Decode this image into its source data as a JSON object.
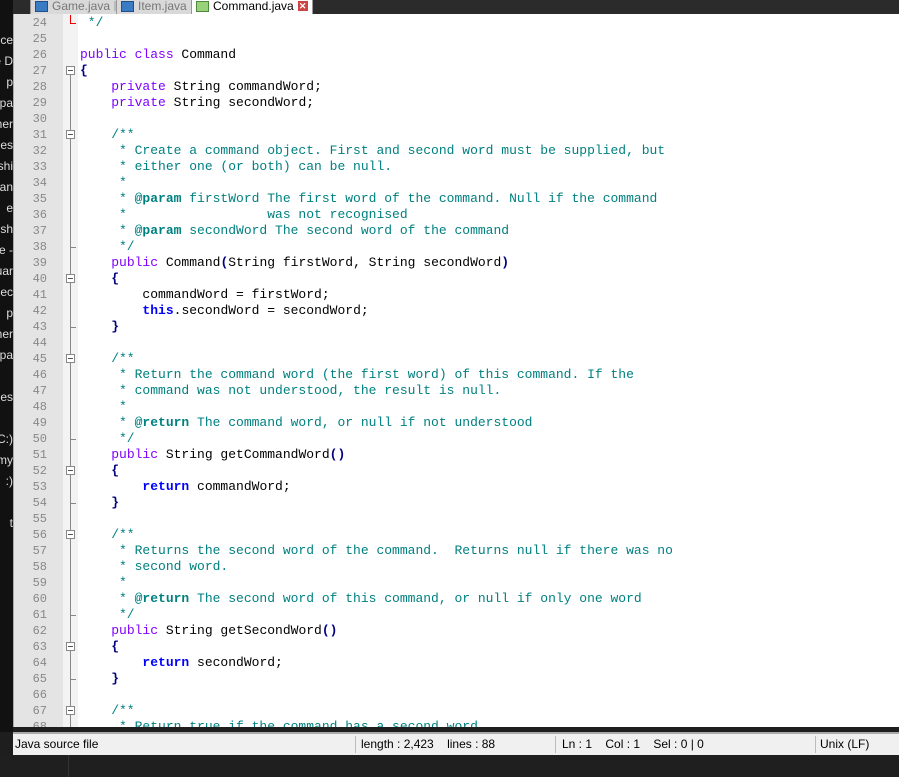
{
  "left_panel": {
    "items": [
      "cce",
      "e D",
      "p",
      "pa",
      "ner",
      "es",
      "shi",
      "an",
      "e",
      "sh",
      "e -",
      "uar",
      "ec",
      "p",
      "ner",
      "pa",
      "",
      "es",
      "",
      "C:)",
      "my",
      ":)",
      "",
      "t"
    ]
  },
  "tabs": [
    {
      "label": "Game.java",
      "active": false
    },
    {
      "label": "Item.java",
      "active": false
    },
    {
      "label": "Command.java",
      "active": true
    }
  ],
  "colors": {
    "keyword": "#8000ff",
    "keyword_bold": "#0000ff",
    "comment": "#008080",
    "fold_end_highlight": "#ee0000"
  },
  "editor": {
    "lines": [
      {
        "n": "24",
        "fold": "end-red",
        "tokens": [
          [
            "c",
            " */"
          ]
        ]
      },
      {
        "n": "25",
        "fold": "",
        "tokens": []
      },
      {
        "n": "26",
        "fold": "",
        "tokens": [
          [
            "k",
            "public class "
          ],
          [
            "p",
            "Command"
          ]
        ]
      },
      {
        "n": "27",
        "fold": "open-top",
        "tokens": [
          [
            "o",
            "{"
          ]
        ]
      },
      {
        "n": "28",
        "fold": "line",
        "tokens": [
          [
            "p",
            "    "
          ],
          [
            "k",
            "private "
          ],
          [
            "p",
            "String commandWord;"
          ]
        ]
      },
      {
        "n": "29",
        "fold": "line",
        "tokens": [
          [
            "p",
            "    "
          ],
          [
            "k",
            "private "
          ],
          [
            "p",
            "String secondWord;"
          ]
        ]
      },
      {
        "n": "30",
        "fold": "line",
        "tokens": []
      },
      {
        "n": "31",
        "fold": "open",
        "tokens": [
          [
            "c",
            "    /**"
          ]
        ]
      },
      {
        "n": "32",
        "fold": "line",
        "tokens": [
          [
            "c",
            "     * Create a command object. First and second word must be supplied, but"
          ]
        ]
      },
      {
        "n": "33",
        "fold": "line",
        "tokens": [
          [
            "c",
            "     * either one (or both) can be null."
          ]
        ]
      },
      {
        "n": "34",
        "fold": "line",
        "tokens": [
          [
            "c",
            "     *"
          ]
        ]
      },
      {
        "n": "35",
        "fold": "line",
        "tokens": [
          [
            "c",
            "     * "
          ],
          [
            "cb",
            "@param"
          ],
          [
            "c",
            " firstWord The first word of the command. Null if the command"
          ]
        ]
      },
      {
        "n": "36",
        "fold": "line",
        "tokens": [
          [
            "c",
            "     *                  was not recognised"
          ]
        ]
      },
      {
        "n": "37",
        "fold": "line",
        "tokens": [
          [
            "c",
            "     * "
          ],
          [
            "cb",
            "@param"
          ],
          [
            "c",
            " secondWord The second word of the command"
          ]
        ]
      },
      {
        "n": "38",
        "fold": "end",
        "tokens": [
          [
            "c",
            "     */"
          ]
        ]
      },
      {
        "n": "39",
        "fold": "line",
        "tokens": [
          [
            "p",
            "    "
          ],
          [
            "k",
            "public "
          ],
          [
            "p",
            "Command"
          ],
          [
            "o",
            "("
          ],
          [
            "p",
            "String firstWord, String secondWord"
          ],
          [
            "o",
            ")"
          ]
        ]
      },
      {
        "n": "40",
        "fold": "open",
        "tokens": [
          [
            "p",
            "    "
          ],
          [
            "o",
            "{"
          ]
        ]
      },
      {
        "n": "41",
        "fold": "line",
        "tokens": [
          [
            "p",
            "        commandWord = firstWord;"
          ]
        ]
      },
      {
        "n": "42",
        "fold": "line",
        "tokens": [
          [
            "p",
            "        "
          ],
          [
            "kb",
            "this"
          ],
          [
            "p",
            ".secondWord = secondWord;"
          ]
        ]
      },
      {
        "n": "43",
        "fold": "end",
        "tokens": [
          [
            "p",
            "    "
          ],
          [
            "o",
            "}"
          ]
        ]
      },
      {
        "n": "44",
        "fold": "line",
        "tokens": []
      },
      {
        "n": "45",
        "fold": "open",
        "tokens": [
          [
            "c",
            "    /**"
          ]
        ]
      },
      {
        "n": "46",
        "fold": "line",
        "tokens": [
          [
            "c",
            "     * Return the command word (the first word) of this command. If the"
          ]
        ]
      },
      {
        "n": "47",
        "fold": "line",
        "tokens": [
          [
            "c",
            "     * command was not understood, the result is null."
          ]
        ]
      },
      {
        "n": "48",
        "fold": "line",
        "tokens": [
          [
            "c",
            "     *"
          ]
        ]
      },
      {
        "n": "49",
        "fold": "line",
        "tokens": [
          [
            "c",
            "     * "
          ],
          [
            "cb",
            "@return"
          ],
          [
            "c",
            " The command word, or null if not understood"
          ]
        ]
      },
      {
        "n": "50",
        "fold": "end",
        "tokens": [
          [
            "c",
            "     */"
          ]
        ]
      },
      {
        "n": "51",
        "fold": "line",
        "tokens": [
          [
            "p",
            "    "
          ],
          [
            "k",
            "public "
          ],
          [
            "p",
            "String getCommandWord"
          ],
          [
            "o",
            "()"
          ]
        ]
      },
      {
        "n": "52",
        "fold": "open",
        "tokens": [
          [
            "p",
            "    "
          ],
          [
            "o",
            "{"
          ]
        ]
      },
      {
        "n": "53",
        "fold": "line",
        "tokens": [
          [
            "p",
            "        "
          ],
          [
            "kb",
            "return "
          ],
          [
            "p",
            "commandWord;"
          ]
        ]
      },
      {
        "n": "54",
        "fold": "end",
        "tokens": [
          [
            "p",
            "    "
          ],
          [
            "o",
            "}"
          ]
        ]
      },
      {
        "n": "55",
        "fold": "line",
        "tokens": []
      },
      {
        "n": "56",
        "fold": "open",
        "tokens": [
          [
            "c",
            "    /**"
          ]
        ]
      },
      {
        "n": "57",
        "fold": "line",
        "tokens": [
          [
            "c",
            "     * Returns the second word of the command.  Returns null if there was no"
          ]
        ]
      },
      {
        "n": "58",
        "fold": "line",
        "tokens": [
          [
            "c",
            "     * second word."
          ]
        ]
      },
      {
        "n": "59",
        "fold": "line",
        "tokens": [
          [
            "c",
            "     *"
          ]
        ]
      },
      {
        "n": "60",
        "fold": "line",
        "tokens": [
          [
            "c",
            "     * "
          ],
          [
            "cb",
            "@return"
          ],
          [
            "c",
            " The second word of this command, or null if only one word"
          ]
        ]
      },
      {
        "n": "61",
        "fold": "end",
        "tokens": [
          [
            "c",
            "     */"
          ]
        ]
      },
      {
        "n": "62",
        "fold": "line",
        "tokens": [
          [
            "p",
            "    "
          ],
          [
            "k",
            "public "
          ],
          [
            "p",
            "String getSecondWord"
          ],
          [
            "o",
            "()"
          ]
        ]
      },
      {
        "n": "63",
        "fold": "open",
        "tokens": [
          [
            "p",
            "    "
          ],
          [
            "o",
            "{"
          ]
        ]
      },
      {
        "n": "64",
        "fold": "line",
        "tokens": [
          [
            "p",
            "        "
          ],
          [
            "kb",
            "return "
          ],
          [
            "p",
            "secondWord;"
          ]
        ]
      },
      {
        "n": "65",
        "fold": "end",
        "tokens": [
          [
            "p",
            "    "
          ],
          [
            "o",
            "}"
          ]
        ]
      },
      {
        "n": "66",
        "fold": "line",
        "tokens": []
      },
      {
        "n": "67",
        "fold": "open",
        "tokens": [
          [
            "c",
            "    /**"
          ]
        ]
      },
      {
        "n": "68",
        "fold": "line",
        "tokens": [
          [
            "c",
            "     * Return true if the command has a second word."
          ]
        ]
      }
    ]
  },
  "status_bar": {
    "file_type": "Java source file",
    "length_lines": "length : 2,423    lines : 88",
    "position": "Ln : 1    Col : 1    Sel : 0 | 0",
    "eol": "Unix (LF)"
  }
}
